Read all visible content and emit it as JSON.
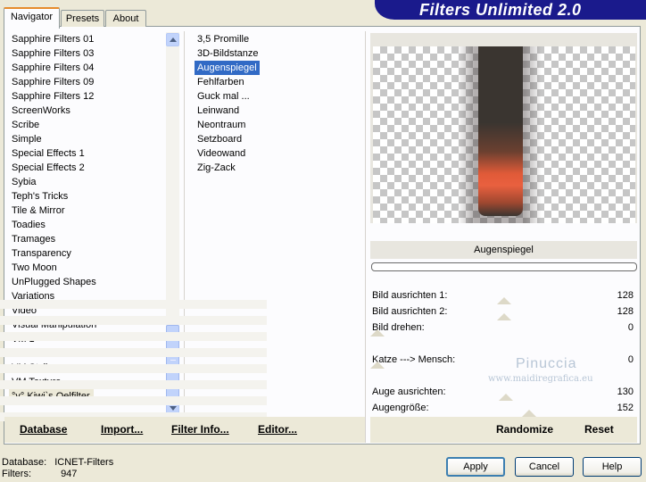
{
  "app_title": "Filters Unlimited 2.0",
  "tabs": [
    {
      "label": "Navigator",
      "active": true
    },
    {
      "label": "Presets",
      "active": false
    },
    {
      "label": "About",
      "active": false
    }
  ],
  "categories": [
    "Sapphire Filters 01",
    "Sapphire Filters 03",
    "Sapphire Filters 04",
    "Sapphire Filters 09",
    "Sapphire Filters 12",
    "ScreenWorks",
    "Scribe",
    "Simple",
    "Special Effects 1",
    "Special Effects 2",
    "Sybia",
    "Teph's Tricks",
    "Tile & Mirror",
    "Toadies",
    "Tramages",
    "Transparency",
    "Two Moon",
    "UnPlugged Shapes",
    "Variations",
    "Video",
    "Visual Manipulation",
    "VM 1",
    "VM Distortion",
    "VM Stylize",
    "VM Texture",
    "°v° Kiwi`s Oelfilter"
  ],
  "selected_category": "°v° Kiwi`s Oelfilter",
  "filters": [
    "3,5 Promille",
    "3D-Bildstanze",
    "Augenspiegel",
    "Fehlfarben",
    "Guck mal ...",
    "Leinwand",
    "Neontraum",
    "Setzboard",
    "Videowand",
    "Zig-Zack"
  ],
  "selected_filter": "Augenspiegel",
  "preview": {
    "filter_name": "Augenspiegel",
    "glow_color": "#e9603f",
    "bar_color": "#3a3530"
  },
  "sliders": [
    {
      "label": "Bild ausrichten 1:",
      "value": "128",
      "level": 0.5
    },
    {
      "label": "Bild ausrichten 2:",
      "value": "128",
      "level": 0.5
    },
    {
      "label": "Bild drehen:",
      "value": "0",
      "level": 0.0
    },
    {
      "label": "",
      "value": "",
      "level": null
    },
    {
      "label": "Katze ---> Mensch:",
      "value": "0",
      "level": 0.0
    },
    {
      "label": "",
      "value": "",
      "level": null
    },
    {
      "label": "Auge ausrichten:",
      "value": "130",
      "level": 0.51
    },
    {
      "label": "Augengröße:",
      "value": "152",
      "level": 0.6
    }
  ],
  "watermark": {
    "name": "Pinuccia",
    "url": "www.maidiregrafica.eu"
  },
  "actions_left": [
    {
      "label": "Database",
      "underline": "D"
    },
    {
      "label": "Import...",
      "underline": "I"
    },
    {
      "label": "Filter Info...",
      "underline": "F"
    },
    {
      "label": "Editor...",
      "underline": "E"
    }
  ],
  "actions_right": [
    "Randomize",
    "Reset"
  ],
  "status": {
    "database_label": "Database:",
    "database_value": "ICNET-Filters",
    "filters_label": "Filters:",
    "filters_value": "947"
  },
  "buttons": {
    "apply": "Apply",
    "cancel": "Cancel",
    "help": "Help"
  }
}
